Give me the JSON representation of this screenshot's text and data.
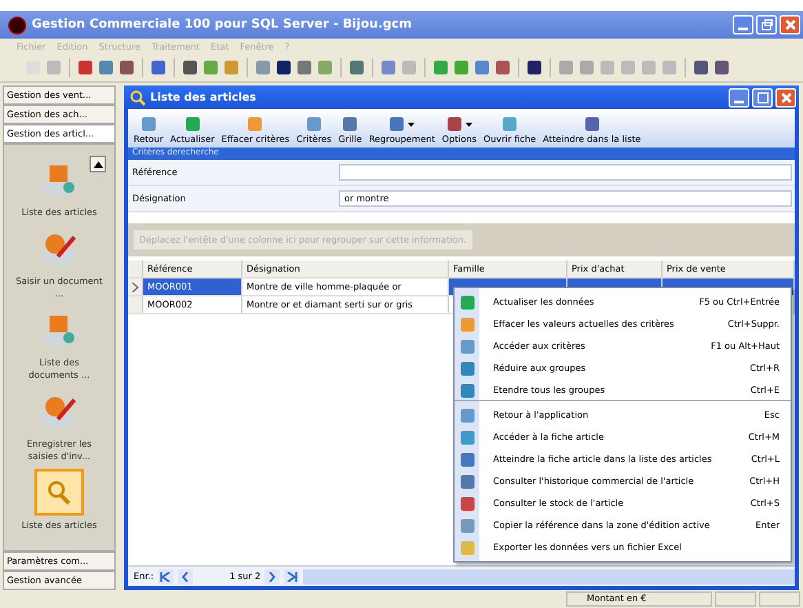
{
  "window": {
    "title": "Gestion Commerciale 100 pour SQL Server - Bijou.gcm"
  },
  "menu": [
    {
      "label": "Fichier"
    },
    {
      "label": "Edition"
    },
    {
      "label": "Structure"
    },
    {
      "label": "Traitement"
    },
    {
      "label": "Etat"
    },
    {
      "label": "Fenêtre"
    },
    {
      "label": "?"
    }
  ],
  "sidebar": {
    "top_groups": [
      {
        "label": "Gestion des vent...",
        "selected": false
      },
      {
        "label": "Gestion des ach...",
        "selected": false
      },
      {
        "label": "Gestion des articl...",
        "selected": true
      }
    ],
    "items": [
      {
        "label": "Liste des articles",
        "selected": false,
        "kind": "box"
      },
      {
        "label": "Saisir un document ...",
        "selected": false,
        "kind": "pen"
      },
      {
        "label": "Liste des documents ...",
        "selected": false,
        "kind": "box"
      },
      {
        "label": "Enregistrer les saisies d'inv...",
        "selected": false,
        "kind": "pen"
      },
      {
        "label": "Liste des articles",
        "selected": true,
        "kind": "search"
      }
    ],
    "bottom_groups": [
      {
        "label": "Paramètres com..."
      },
      {
        "label": "Gestion avancée"
      }
    ]
  },
  "child_window": {
    "title": "Liste des articles",
    "toolbar": [
      {
        "label": "Retour",
        "dropdown": false
      },
      {
        "label": "Actualiser",
        "dropdown": false
      },
      {
        "label": "Effacer critères",
        "dropdown": false
      },
      {
        "label": "Critères",
        "dropdown": false
      },
      {
        "label": "Grille",
        "dropdown": false
      },
      {
        "label": "Regroupement",
        "dropdown": true
      },
      {
        "label": "Options",
        "dropdown": true
      },
      {
        "label": "Ouvrir fiche",
        "dropdown": false
      },
      {
        "label": "Atteindre dans la liste",
        "dropdown": false
      }
    ],
    "criteria": {
      "title": "Critères derecherche",
      "fields": [
        {
          "label": "Référence"
        },
        {
          "label": "Désignation",
          "value": "or montre"
        }
      ]
    },
    "group_hint": "Déplacez l'entête d'une colonne ici pour regrouper sur cette information.",
    "table": {
      "columns": [
        "Référence",
        "Désignation",
        "Famille",
        "Prix d'achat",
        "Prix de vente"
      ],
      "rows": [
        {
          "reference": "MOOR001",
          "designation": "Montre de ville homme-plaquée or",
          "selected": true
        },
        {
          "reference": "MOOR002",
          "designation": "Montre or et diamant serti sur or gris",
          "selected": false
        }
      ]
    },
    "pager": {
      "label": "Enr.:",
      "position": "1 sur 2"
    }
  },
  "context_menu": [
    {
      "label": "Actualiser les données",
      "shortcut": "F5 ou Ctrl+Entrée",
      "separator_after": false
    },
    {
      "label": "Effacer les valeurs actuelles des critères",
      "shortcut": "Ctrl+Suppr.",
      "separator_after": false
    },
    {
      "label": "Accéder aux critères",
      "shortcut": "F1 ou Alt+Haut",
      "separator_after": false
    },
    {
      "label": "Réduire aux groupes",
      "shortcut": "Ctrl+R",
      "separator_after": false
    },
    {
      "label": "Etendre tous les groupes",
      "shortcut": "Ctrl+E",
      "separator_after": true
    },
    {
      "label": "Retour à l'application",
      "shortcut": "Esc",
      "separator_after": false
    },
    {
      "label": "Accéder à la fiche article",
      "shortcut": "Ctrl+M",
      "separator_after": false
    },
    {
      "label": "Atteindre la fiche article dans la liste des articles",
      "shortcut": "Ctrl+L",
      "separator_after": false
    },
    {
      "label": "Consulter l'historique commercial de l'article",
      "shortcut": "Ctrl+H",
      "separator_after": false
    },
    {
      "label": "Consulter le stock de l'article",
      "shortcut": "Ctrl+S",
      "separator_after": false
    },
    {
      "label": "Copier la référence dans la zone d'édition active",
      "shortcut": "Enter",
      "separator_after": false
    },
    {
      "label": "Exporter les données vers un fichier Excel",
      "separator_after": false
    }
  ],
  "status_bar": {
    "text": "Montant en €"
  }
}
